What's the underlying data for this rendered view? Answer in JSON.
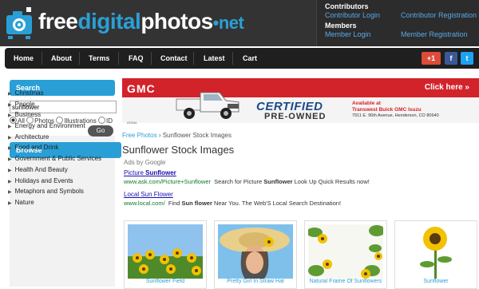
{
  "header": {
    "logo_text": {
      "free": "free",
      "digital": "digital",
      "photos": "photos",
      "net": "•net"
    },
    "contributors_heading": "Contributors",
    "contributor_login": "Contributor Login",
    "contributor_registration": "Contributor Registration",
    "members_heading": "Members",
    "member_login": "Member Login",
    "member_registration": "Member Registration"
  },
  "nav": {
    "items": [
      "Home",
      "About",
      "Terms",
      "FAQ",
      "Contact",
      "Latest",
      "Cart"
    ],
    "social": {
      "gplus": "+1",
      "facebook": "f",
      "twitter": "t"
    }
  },
  "sidebar": {
    "search_heading": "Search",
    "search_value": "sunflower",
    "radio_options": [
      "All",
      "Photos",
      "Illustrations",
      "ID"
    ],
    "go_label": "Go",
    "browse_heading": "Browse",
    "categories": [
      "Christmas",
      "People",
      "Business",
      "Energy and Environment",
      "Architecture",
      "Food and Drink",
      "Government & Public Services",
      "Health And Beauty",
      "Holidays and Events",
      "Metaphors and Symbols",
      "Nature"
    ]
  },
  "ad_banner": {
    "brand": "GMC",
    "click_here": "Click here »",
    "certified": "CERTIFIED",
    "pre_owned": "PRE-OWNED",
    "available_at": "Available at",
    "dealer": "Transwest Buick GMC Isuzu",
    "address": "7911 E. 96th Avenue, Henderson, CO 80640",
    "legal": "LEGAL"
  },
  "main": {
    "breadcrumb_home": "Free Photos",
    "breadcrumb_sep": "›",
    "breadcrumb_current": "Sunflower Stock Images",
    "title": "Sunflower Stock Images",
    "ads_by": "Ads by Google",
    "ads": [
      {
        "title_pre": "Picture ",
        "title_bold": "Sunflower",
        "url": "www.ask.com/Picture+Sunflower",
        "desc_pre": "Search for Picture ",
        "desc_bold": "Sunflower",
        "desc_post": " Look Up Quick Results now!"
      },
      {
        "title_pre": "Local Sun Flower",
        "title_bold": "",
        "url": "www.local.com/",
        "desc_pre": "Find ",
        "desc_bold": "Sun flower",
        "desc_post": " Near You. The Web'S Local Search Destination!"
      }
    ],
    "thumbnails": [
      {
        "caption": "Sunflower Field"
      },
      {
        "caption": "Pretty Girl In Straw Hat"
      },
      {
        "caption": "Natural Frame Of Sunflowers"
      },
      {
        "caption": "Sunflower"
      }
    ]
  },
  "colors": {
    "accent": "#2a9fd6",
    "header_bg": "#333333",
    "nav_bg": "#1f1f1f",
    "gmc_red": "#d2232a"
  }
}
